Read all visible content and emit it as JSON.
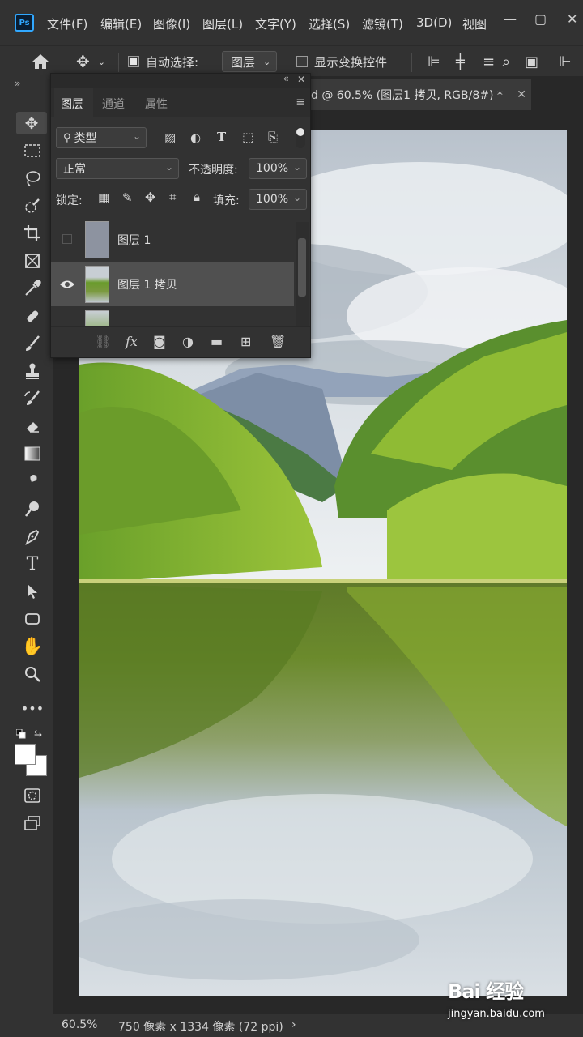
{
  "menubar": {
    "items": [
      "文件(F)",
      "编辑(E)",
      "图像(I)",
      "图层(L)",
      "文字(Y)",
      "选择(S)",
      "滤镜(T)",
      "3D(D)",
      "视图"
    ],
    "logo": "Ps"
  },
  "options": {
    "auto_select_label": "自动选择:",
    "auto_select_value": "图层",
    "show_transform_label": "显示变换控件"
  },
  "document_tab": {
    "title": "d @ 60.5% (图层1 拷贝, RGB/8#) *"
  },
  "layers_panel": {
    "tabs": [
      "图层",
      "通道",
      "属性"
    ],
    "filter_kind": "类型",
    "blend_mode": "正常",
    "opacity_label": "不透明度:",
    "opacity_value": "100%",
    "lock_label": "锁定:",
    "fill_label": "填充:",
    "fill_value": "100%",
    "layers": [
      {
        "name": "图层 1",
        "visible": false,
        "selected": false
      },
      {
        "name": "图层 1 拷贝",
        "visible": true,
        "selected": true
      }
    ]
  },
  "status_bar": {
    "zoom": "60.5%",
    "doc_info": "750 像素 x 1334 像素 (72 ppi)"
  },
  "watermark": {
    "main": "Bai 经验",
    "sub": "jingyan.baidu.com"
  },
  "colors": {
    "accent": "#31a8ff",
    "ui_bg": "#323232",
    "canvas_bg": "#282828"
  }
}
